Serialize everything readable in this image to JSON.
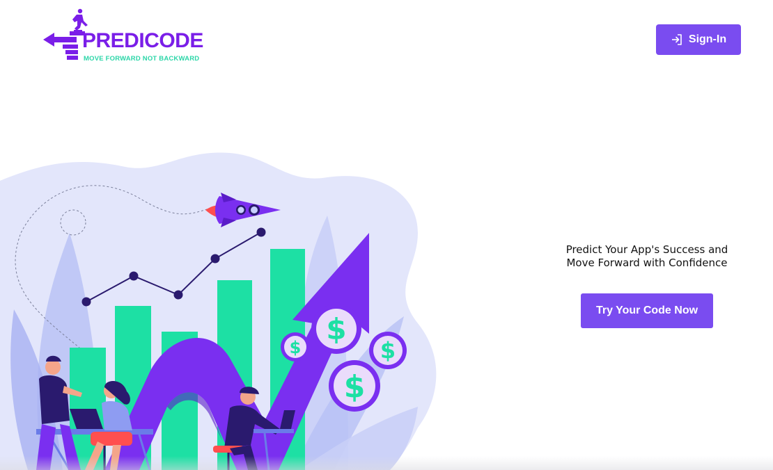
{
  "header": {
    "logo": {
      "name": "PREDICODE",
      "tagline": "MOVE FORWARD NOT BACKWARD"
    },
    "signin_label": "Sign-In"
  },
  "hero": {
    "headline": "Predict Your App's Success and Move Forward with Confidence",
    "cta_label": "Try Your Code Now"
  },
  "colors": {
    "primary": "#7a4cf0",
    "brand_purple": "#7a1ee8",
    "accent_green": "#2bd6a8",
    "white": "#ffffff"
  },
  "icons": {
    "signin": "login-arrow-icon"
  }
}
